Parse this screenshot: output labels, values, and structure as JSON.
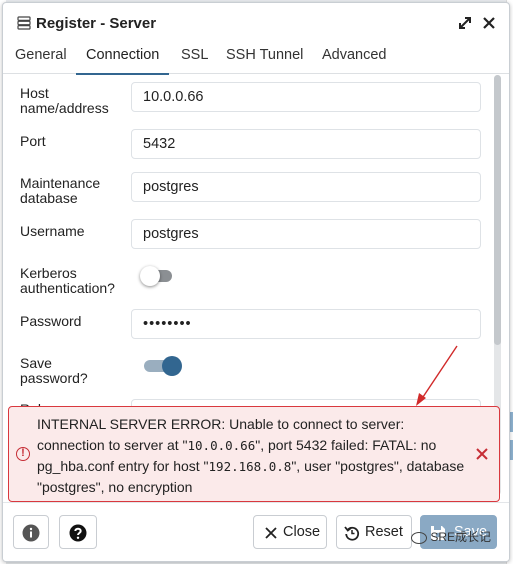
{
  "window": {
    "title": "Register - Server"
  },
  "tabs": [
    {
      "label": "General",
      "active": false
    },
    {
      "label": "Connection",
      "active": true
    },
    {
      "label": "SSL",
      "active": false
    },
    {
      "label": "SSH Tunnel",
      "active": false
    },
    {
      "label": "Advanced",
      "active": false
    }
  ],
  "form": {
    "host_label_1": "Host",
    "host_label_2": "name/address",
    "host_value": "10.0.0.66",
    "port_label": "Port",
    "port_value": "5432",
    "maint_label_1": "Maintenance",
    "maint_label_2": "database",
    "maint_value": "postgres",
    "username_label": "Username",
    "username_value": "postgres",
    "kerberos_label_1": "Kerberos",
    "kerberos_label_2": "authentication?",
    "kerberos_enabled": false,
    "password_label": "Password",
    "password_value": "••••••••",
    "save_pw_label_1": "Save",
    "save_pw_label_2": "password?",
    "save_pw_enabled": true,
    "role_label": "Role"
  },
  "error": {
    "part1": "INTERNAL SERVER ERROR: Unable to connect to server: connection to server at \"",
    "ip1": "10.0.0.66",
    "part2": "\", port 5432 failed: FATAL: no pg_hba.conf entry for host \"",
    "ip2": "192.168.0.8",
    "part3": "\", user \"postgres\", database \"postgres\", no encryption"
  },
  "footer": {
    "close_label": "Close",
    "reset_label": "Reset",
    "save_label": "Save",
    "watermark": "SRE成长记"
  },
  "colors": {
    "accent": "#326690",
    "error_border": "#d9383e",
    "error_bg": "#fbeaea"
  }
}
